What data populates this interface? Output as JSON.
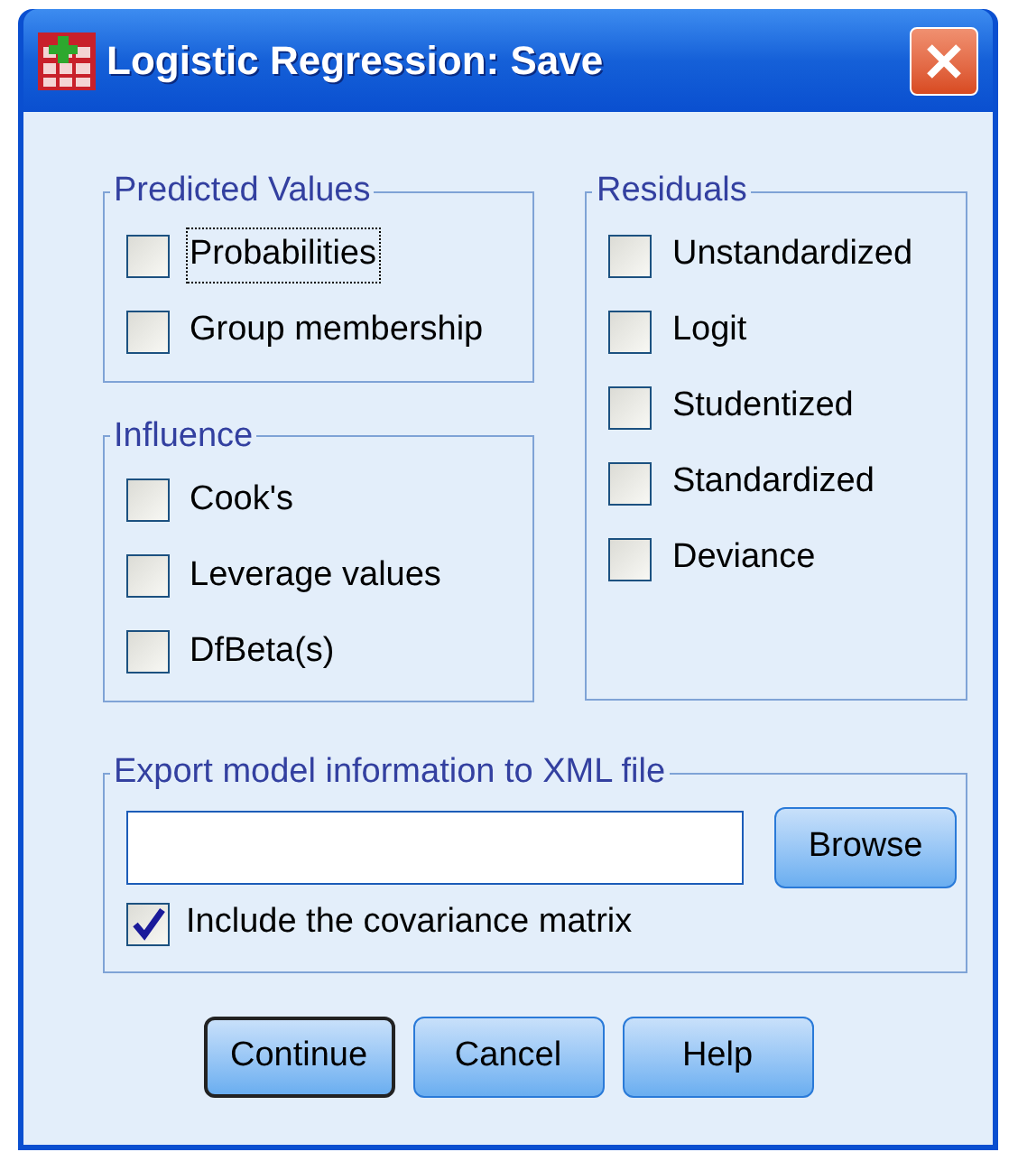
{
  "window": {
    "title": "Logistic Regression: Save"
  },
  "groups": [
    {
      "title": "Predicted Values",
      "items": [
        {
          "label": "Probabilities",
          "checked": false,
          "focused": true
        },
        {
          "label": "Group membership",
          "checked": false,
          "focused": false
        }
      ]
    },
    {
      "title": "Influence",
      "items": [
        {
          "label": "Cook's",
          "checked": false,
          "focused": false
        },
        {
          "label": "Leverage values",
          "checked": false,
          "focused": false
        },
        {
          "label": "DfBeta(s)",
          "checked": false,
          "focused": false
        }
      ]
    },
    {
      "title": "Residuals",
      "items": [
        {
          "label": "Unstandardized",
          "checked": false,
          "focused": false
        },
        {
          "label": "Logit",
          "checked": false,
          "focused": false
        },
        {
          "label": "Studentized",
          "checked": false,
          "focused": false
        },
        {
          "label": "Standardized",
          "checked": false,
          "focused": false
        },
        {
          "label": "Deviance",
          "checked": false,
          "focused": false
        }
      ]
    }
  ],
  "export": {
    "title": "Export model information to XML file",
    "browse": "Browse",
    "include": {
      "label": "Include the covariance matrix",
      "checked": true
    }
  },
  "buttons": [
    {
      "label": "Continue",
      "default": true
    },
    {
      "label": "Cancel",
      "default": false
    },
    {
      "label": "Help",
      "default": false
    }
  ]
}
